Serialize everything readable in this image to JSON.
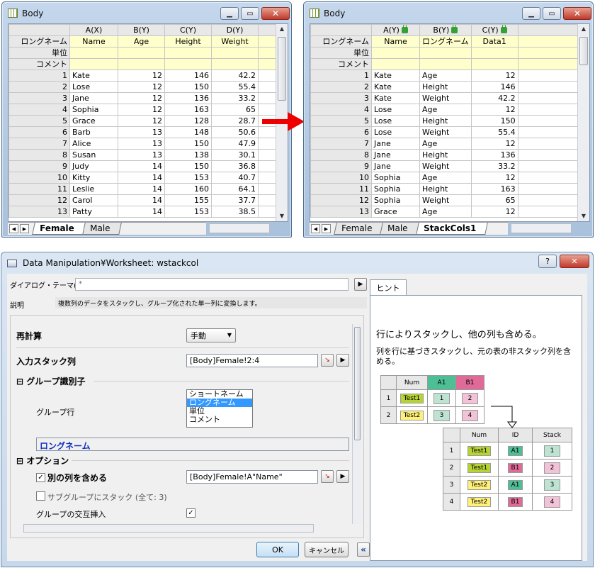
{
  "win1": {
    "title": "Body",
    "cols": [
      "A(X)",
      "B(Y)",
      "C(Y)",
      "D(Y)"
    ],
    "meta_labels": [
      "ロングネーム",
      "単位",
      "コメント"
    ],
    "longnames": [
      "Name",
      "Age",
      "Height",
      "Weight"
    ],
    "rows": [
      [
        "1",
        "Kate",
        "12",
        "146",
        "42.2"
      ],
      [
        "2",
        "Lose",
        "12",
        "150",
        "55.4"
      ],
      [
        "3",
        "Jane",
        "12",
        "136",
        "33.2"
      ],
      [
        "4",
        "Sophia",
        "12",
        "163",
        "65"
      ],
      [
        "5",
        "Grace",
        "12",
        "128",
        "28.7"
      ],
      [
        "6",
        "Barb",
        "13",
        "148",
        "50.6"
      ],
      [
        "7",
        "Alice",
        "13",
        "150",
        "47.9"
      ],
      [
        "8",
        "Susan",
        "13",
        "138",
        "30.1"
      ],
      [
        "9",
        "Judy",
        "14",
        "150",
        "36.8"
      ],
      [
        "10",
        "Kitty",
        "14",
        "153",
        "40.7"
      ],
      [
        "11",
        "Leslie",
        "14",
        "160",
        "64.1"
      ],
      [
        "12",
        "Carol",
        "14",
        "155",
        "37.7"
      ],
      [
        "13",
        "Patty",
        "14",
        "153",
        "38.5"
      ]
    ],
    "tabs": [
      "Female",
      "Male"
    ]
  },
  "win2": {
    "title": "Body",
    "cols": [
      "A(Y)",
      "B(Y)",
      "C(Y)"
    ],
    "meta_labels": [
      "ロングネーム",
      "単位",
      "コメント"
    ],
    "longnames": [
      "Name",
      "ロングネーム",
      "Data1"
    ],
    "rows": [
      [
        "1",
        "Kate",
        "Age",
        "12"
      ],
      [
        "2",
        "Kate",
        "Height",
        "146"
      ],
      [
        "3",
        "Kate",
        "Weight",
        "42.2"
      ],
      [
        "4",
        "Lose",
        "Age",
        "12"
      ],
      [
        "5",
        "Lose",
        "Height",
        "150"
      ],
      [
        "6",
        "Lose",
        "Weight",
        "55.4"
      ],
      [
        "7",
        "Jane",
        "Age",
        "12"
      ],
      [
        "8",
        "Jane",
        "Height",
        "136"
      ],
      [
        "9",
        "Jane",
        "Weight",
        "33.2"
      ],
      [
        "10",
        "Sophia",
        "Age",
        "12"
      ],
      [
        "11",
        "Sophia",
        "Height",
        "163"
      ],
      [
        "12",
        "Sophia",
        "Weight",
        "65"
      ],
      [
        "13",
        "Grace",
        "Age",
        "12"
      ]
    ],
    "tabs": [
      "Female",
      "Male",
      "StackCols1"
    ]
  },
  "dialog": {
    "title": "Data Manipulation¥Worksheet: wstackcol",
    "help": "?",
    "close": "✕",
    "theme_label": "ダイアログ・テーマ(H)",
    "theme_value": "*",
    "desc_label": "説明",
    "desc_value": "複数列のデータをスタックし、グループ化された単一列に変換します。",
    "recalc_label": "再計算",
    "recalc_value": "手動",
    "input_label": "入力スタック列",
    "input_value": "[Body]Female!2:4",
    "group_label": "グループ識別子",
    "group_row_label": "グループ行",
    "list": [
      "ショートネーム",
      "ロングネーム",
      "単位",
      "コメント"
    ],
    "list_selected": 1,
    "group_result": "ロングネーム",
    "options_label": "オプション",
    "include_label": "別の列を含める",
    "include_value": "[Body]Female!A\"Name\"",
    "subgroup_label": "サブグループにスタック (全て: 3)",
    "interleave_label": "グループの交互挿入",
    "ok": "OK",
    "cancel": "キャンセル",
    "collapse": "«",
    "hint_tab": "ヒント",
    "hint_title": "行によりスタックし、他の列も含める。",
    "hint_text": "列を行に基づきスタックし、元の表の非スタック列を含める。"
  },
  "hint_t1": {
    "head": [
      "",
      "Num",
      "A1",
      "B1"
    ],
    "rows": [
      [
        "1",
        "Test1",
        "1",
        "2"
      ],
      [
        "2",
        "Test2",
        "3",
        "4"
      ]
    ]
  },
  "hint_t2": {
    "head": [
      "",
      "Num",
      "ID",
      "Stack"
    ],
    "rows": [
      [
        "1",
        "Test1",
        "A1",
        "1"
      ],
      [
        "2",
        "Test1",
        "B1",
        "2"
      ],
      [
        "3",
        "Test2",
        "A1",
        "3"
      ],
      [
        "4",
        "Test2",
        "B1",
        "4"
      ]
    ]
  }
}
